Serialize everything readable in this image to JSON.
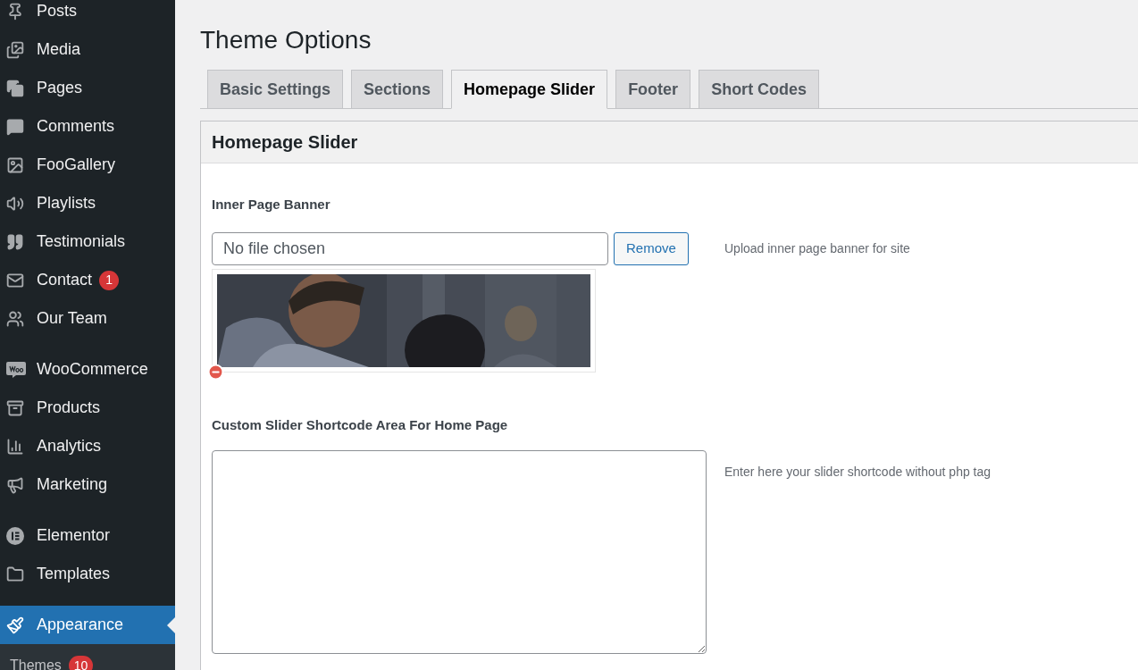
{
  "sidebar": {
    "groups": [
      {
        "items": [
          {
            "label": "Posts",
            "selected": false
          },
          {
            "label": "Media",
            "selected": false
          },
          {
            "label": "Pages",
            "selected": false
          },
          {
            "label": "Comments",
            "selected": false
          },
          {
            "label": "FooGallery",
            "selected": false
          },
          {
            "label": "Playlists",
            "selected": false
          },
          {
            "label": "Testimonials",
            "selected": false
          },
          {
            "label": "Contact",
            "badge": "1",
            "selected": false
          },
          {
            "label": "Our Team",
            "selected": false
          }
        ]
      },
      {
        "items": [
          {
            "label": "WooCommerce",
            "selected": false
          },
          {
            "label": "Products",
            "selected": false
          },
          {
            "label": "Analytics",
            "selected": false
          },
          {
            "label": "Marketing",
            "selected": false
          }
        ]
      },
      {
        "items": [
          {
            "label": "Elementor",
            "selected": false
          },
          {
            "label": "Templates",
            "selected": false
          }
        ]
      },
      {
        "items": [
          {
            "label": "Appearance",
            "selected": true,
            "children": [
              {
                "label": "Themes",
                "badge": "10"
              }
            ]
          }
        ]
      }
    ]
  },
  "page": {
    "title": "Theme Options"
  },
  "tabs": [
    {
      "label": "Basic Settings",
      "selected": false
    },
    {
      "label": "Sections",
      "selected": false
    },
    {
      "label": "Homepage Slider",
      "selected": true
    },
    {
      "label": "Footer",
      "selected": false
    },
    {
      "label": "Short Codes",
      "selected": false
    }
  ],
  "panel": {
    "title": "Homepage Slider",
    "fields": [
      {
        "kind": "upload",
        "label": "Inner Page Banner",
        "placeholder": "No file chosen",
        "button": "Remove",
        "description": "Upload inner page banner for site"
      },
      {
        "kind": "textarea",
        "label": "Custom Slider Shortcode Area For Home Page",
        "description": "Enter here your slider shortcode without php tag"
      }
    ]
  }
}
